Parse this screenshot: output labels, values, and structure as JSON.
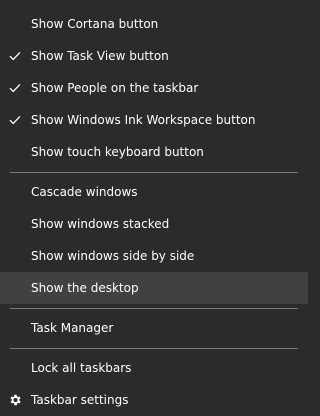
{
  "menu": {
    "group1": [
      {
        "label": "Show Cortana button",
        "checked": false
      },
      {
        "label": "Show Task View button",
        "checked": true
      },
      {
        "label": "Show People on the taskbar",
        "checked": true
      },
      {
        "label": "Show Windows Ink Workspace button",
        "checked": true
      },
      {
        "label": "Show touch keyboard button",
        "checked": false
      }
    ],
    "group2": [
      {
        "label": "Cascade windows"
      },
      {
        "label": "Show windows stacked"
      },
      {
        "label": "Show windows side by side"
      },
      {
        "label": "Show the desktop",
        "highlighted": true
      }
    ],
    "group3": [
      {
        "label": "Task Manager"
      }
    ],
    "group4": [
      {
        "label": "Lock all taskbars",
        "checked": false
      },
      {
        "label": "Taskbar settings",
        "icon": "gear-icon"
      }
    ]
  },
  "colors": {
    "background": "#2b2b2b",
    "highlight": "#414141",
    "separator": "#7a7a7a",
    "text": "#ffffff"
  }
}
